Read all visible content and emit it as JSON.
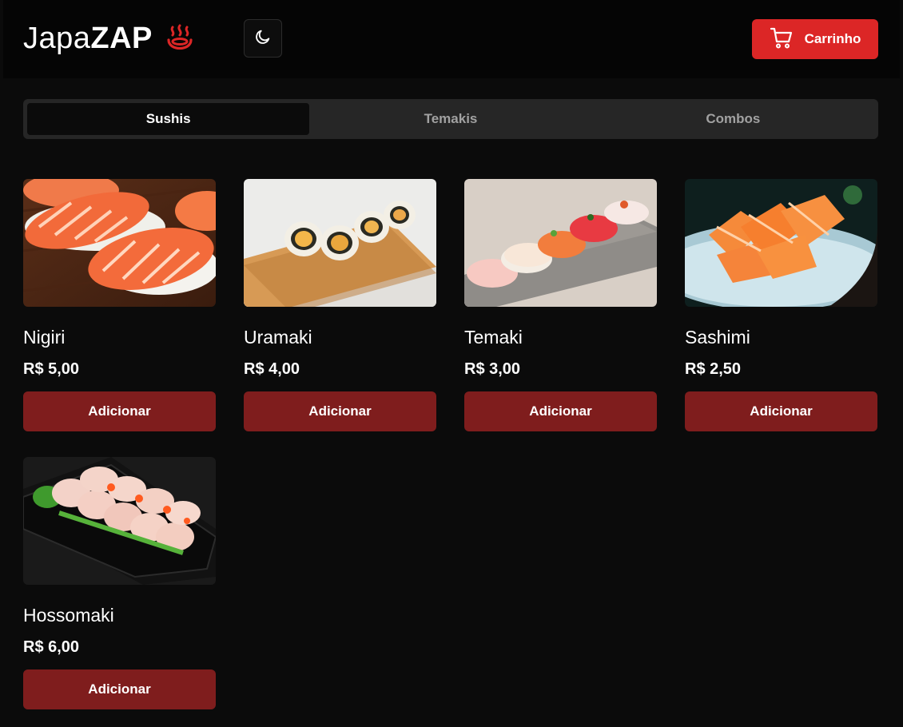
{
  "brand": {
    "name_light": "Japa",
    "name_bold": "ZAP",
    "flame_icon": "hot-springs-icon",
    "accent": "#dc2626"
  },
  "header": {
    "theme_toggle_icon": "moon-icon",
    "cart_label": "Carrinho",
    "cart_icon": "shopping-cart-icon"
  },
  "tabs": [
    {
      "label": "Sushis",
      "active": true
    },
    {
      "label": "Temakis",
      "active": false
    },
    {
      "label": "Combos",
      "active": false
    }
  ],
  "products": [
    {
      "name": "Nigiri",
      "price": "R$ 5,00",
      "button": "Adicionar"
    },
    {
      "name": "Uramaki",
      "price": "R$ 4,00",
      "button": "Adicionar"
    },
    {
      "name": "Temaki",
      "price": "R$ 3,00",
      "button": "Adicionar"
    },
    {
      "name": "Sashimi",
      "price": "R$ 2,50",
      "button": "Adicionar"
    },
    {
      "name": "Hossomaki",
      "price": "R$ 6,00",
      "button": "Adicionar"
    }
  ],
  "colors": {
    "background": "#0b0b0b",
    "add_button": "#7f1d1d",
    "cart_button": "#dc2626",
    "tab_bar": "#262626"
  }
}
